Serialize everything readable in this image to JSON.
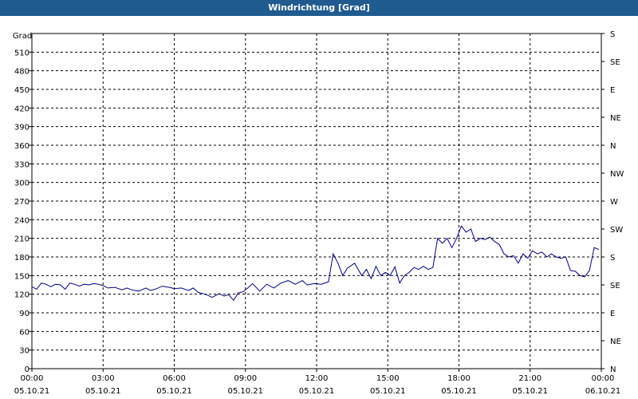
{
  "window": {
    "title": "Windrichtung [Grad]"
  },
  "chart_data": {
    "type": "line",
    "ylabel": "Grad",
    "ylim": [
      0,
      540
    ],
    "y_ticks": [
      0,
      30,
      60,
      90,
      120,
      150,
      180,
      210,
      240,
      270,
      300,
      330,
      360,
      390,
      420,
      450,
      480,
      510
    ],
    "right_axis": {
      "ticks": [
        {
          "value": 0,
          "label": "N"
        },
        {
          "value": 45,
          "label": "NE"
        },
        {
          "value": 90,
          "label": "E"
        },
        {
          "value": 135,
          "label": "SE"
        },
        {
          "value": 180,
          "label": "S"
        },
        {
          "value": 225,
          "label": "SW"
        },
        {
          "value": 270,
          "label": "W"
        },
        {
          "value": 315,
          "label": "NW"
        },
        {
          "value": 360,
          "label": "N"
        },
        {
          "value": 405,
          "label": "NE"
        },
        {
          "value": 450,
          "label": "E"
        },
        {
          "value": 495,
          "label": "SE"
        },
        {
          "value": 540,
          "label": "S"
        }
      ]
    },
    "xlim_hours": [
      0,
      24
    ],
    "x_ticks": [
      {
        "hour": 0,
        "time": "00:00",
        "date": "05.10.21"
      },
      {
        "hour": 3,
        "time": "03:00",
        "date": "05.10.21"
      },
      {
        "hour": 6,
        "time": "06:00",
        "date": "05.10.21"
      },
      {
        "hour": 9,
        "time": "09:00",
        "date": "05.10.21"
      },
      {
        "hour": 12,
        "time": "12:00",
        "date": "05.10.21"
      },
      {
        "hour": 15,
        "time": "15:00",
        "date": "05.10.21"
      },
      {
        "hour": 18,
        "time": "18:00",
        "date": "05.10.21"
      },
      {
        "hour": 21,
        "time": "21:00",
        "date": "05.10.21"
      },
      {
        "hour": 24,
        "time": "00:00",
        "date": "06.10.21"
      }
    ],
    "grid": true,
    "series": [
      {
        "color": "#000080",
        "x": [
          0,
          0.2,
          0.4,
          0.6,
          0.8,
          1.0,
          1.2,
          1.4,
          1.6,
          1.8,
          2.0,
          2.2,
          2.4,
          2.6,
          2.8,
          3.0,
          3.2,
          3.5,
          3.8,
          4.0,
          4.2,
          4.5,
          4.8,
          5.0,
          5.2,
          5.5,
          5.8,
          6.0,
          6.3,
          6.6,
          6.8,
          7.0,
          7.3,
          7.6,
          7.9,
          8.1,
          8.3,
          8.5,
          8.7,
          8.9,
          9.1,
          9.3,
          9.6,
          9.9,
          10.2,
          10.5,
          10.8,
          11.1,
          11.4,
          11.6,
          11.9,
          12.2,
          12.5,
          12.7,
          12.9,
          13.1,
          13.3,
          13.6,
          13.9,
          14.1,
          14.3,
          14.5,
          14.7,
          14.9,
          15.1,
          15.3,
          15.5,
          15.7,
          15.9,
          16.1,
          16.3,
          16.5,
          16.7,
          16.9,
          17.1,
          17.3,
          17.5,
          17.7,
          17.9,
          18.1,
          18.3,
          18.5,
          18.7,
          18.9,
          19.1,
          19.3,
          19.5,
          19.7,
          19.9,
          20.1,
          20.3,
          20.5,
          20.7,
          20.9,
          21.1,
          21.3,
          21.5,
          21.7,
          21.9,
          22.1,
          22.3,
          22.5,
          22.7,
          22.9,
          23.1,
          23.3,
          23.5,
          23.7,
          23.9
        ],
        "y": [
          132,
          128,
          138,
          136,
          132,
          136,
          135,
          128,
          138,
          136,
          133,
          136,
          135,
          137,
          136,
          134,
          130,
          131,
          127,
          130,
          127,
          125,
          130,
          126,
          128,
          133,
          131,
          129,
          130,
          126,
          130,
          123,
          120,
          115,
          121,
          117,
          119,
          110,
          122,
          124,
          130,
          137,
          125,
          136,
          130,
          138,
          142,
          136,
          142,
          135,
          137,
          136,
          140,
          185,
          170,
          150,
          162,
          170,
          150,
          160,
          145,
          165,
          150,
          155,
          150,
          164,
          138,
          150,
          155,
          163,
          160,
          165,
          160,
          163,
          210,
          202,
          210,
          195,
          210,
          230,
          220,
          225,
          205,
          210,
          208,
          212,
          205,
          200,
          185,
          180,
          182,
          170,
          185,
          178,
          190,
          185,
          188,
          180,
          185,
          180,
          178,
          180,
          158,
          157,
          150,
          148,
          158,
          195,
          192
        ]
      }
    ]
  }
}
